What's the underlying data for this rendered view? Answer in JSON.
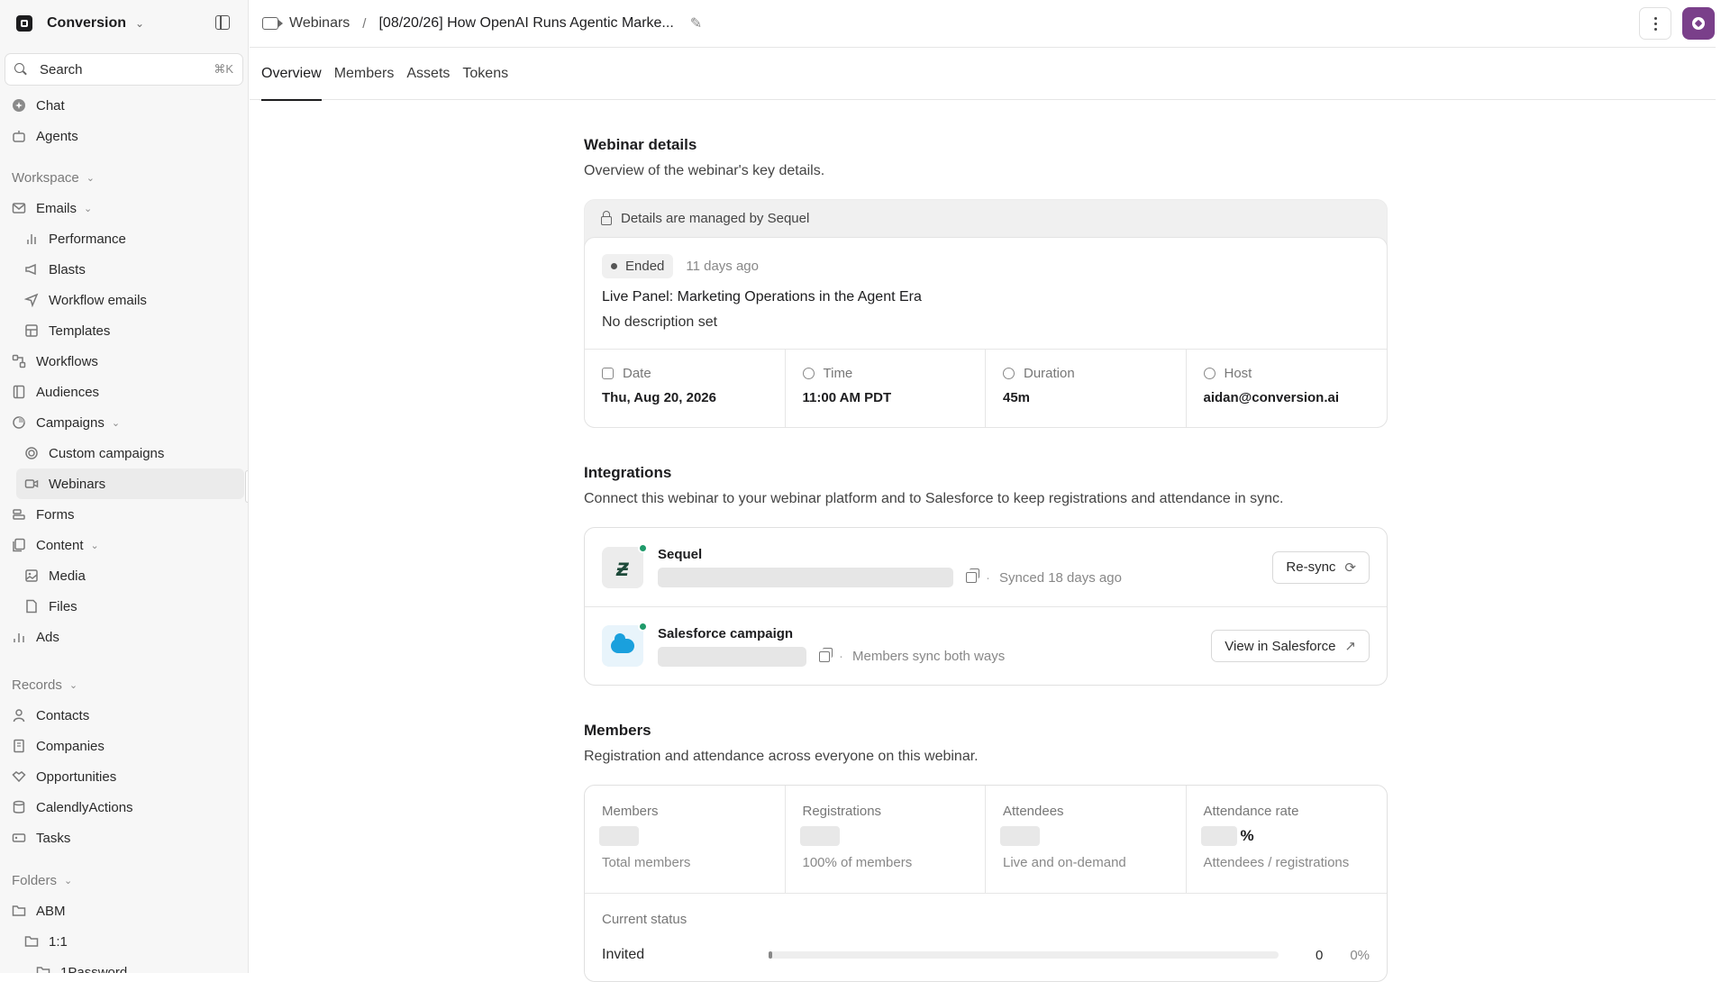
{
  "workspace": {
    "name": "Conversion"
  },
  "search": {
    "label": "Search",
    "shortcut": "⌘K"
  },
  "nav_top": [
    {
      "label": "Chat",
      "icon": "chat-icon"
    },
    {
      "label": "Agents",
      "icon": "agents-icon"
    }
  ],
  "sections": {
    "workspace": "Workspace",
    "records": "Records",
    "folders": "Folders"
  },
  "nav_workspace": {
    "emails": "Emails",
    "performance": "Performance",
    "blasts": "Blasts",
    "workflow_emails": "Workflow emails",
    "templates": "Templates",
    "workflows": "Workflows",
    "audiences": "Audiences",
    "campaigns": "Campaigns",
    "custom_campaigns": "Custom campaigns",
    "webinars": "Webinars",
    "forms": "Forms",
    "content": "Content",
    "media": "Media",
    "files": "Files",
    "ads": "Ads"
  },
  "nav_records": {
    "contacts": "Contacts",
    "companies": "Companies",
    "opportunities": "Opportunities",
    "calendly": "CalendlyActions",
    "tasks": "Tasks"
  },
  "nav_folders": {
    "abm": "ABM",
    "one_on_one": "1:1",
    "onepassword": "1Password"
  },
  "breadcrumb": {
    "parent": "Webinars",
    "separator": "/",
    "title": "[08/20/26] How OpenAI Runs Agentic Marke..."
  },
  "tabs": [
    "Overview",
    "Members",
    "Assets",
    "Tokens"
  ],
  "webinar_details": {
    "heading": "Webinar details",
    "description": "Overview of the webinar's key details.",
    "managed_note": "Details are managed by Sequel",
    "status": "Ended",
    "ago": "11 days ago",
    "title": "Live Panel: Marketing Operations in the Agent Era",
    "event_description": "No description set",
    "meta": {
      "date_label": "Date",
      "date_value": "Thu, Aug 20, 2026",
      "time_label": "Time",
      "time_value": "11:00 AM PDT",
      "duration_label": "Duration",
      "duration_value": "45m",
      "host_label": "Host",
      "host_value": "aidan@conversion.ai"
    }
  },
  "integrations": {
    "heading": "Integrations",
    "description": "Connect this webinar to your webinar platform and to Salesforce to keep registrations and attendance in sync.",
    "sequel": {
      "name": "Sequel",
      "sync_text": "Synced 18 days ago",
      "button": "Re-sync"
    },
    "salesforce": {
      "name": "Salesforce campaign",
      "sync_text": "Members sync both ways",
      "button": "View in Salesforce"
    },
    "separator": "·"
  },
  "members": {
    "heading": "Members",
    "description": "Registration and attendance across everyone on this webinar.",
    "stats": {
      "members_label": "Members",
      "members_sub": "Total members",
      "registrations_label": "Registrations",
      "registrations_sub": "100% of members",
      "attendees_label": "Attendees",
      "attendees_sub": "Live and on-demand",
      "rate_label": "Attendance rate",
      "rate_unit": "%",
      "rate_sub": "Attendees / registrations"
    },
    "current_status_label": "Current status",
    "status_rows": [
      {
        "name": "Invited",
        "count": "0",
        "pct": "0%",
        "fraction": 0
      }
    ]
  },
  "colors": {
    "accent": "#7a3f8a",
    "online": "#1f9a6a",
    "salesforce": "#1aa0dd"
  }
}
